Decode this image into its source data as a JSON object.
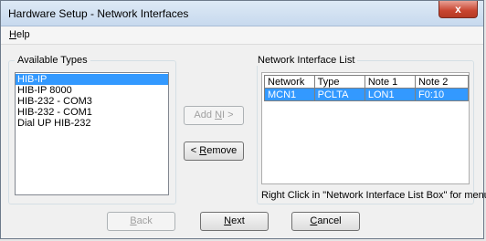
{
  "window": {
    "title": "Hardware Setup - Network Interfaces",
    "close_glyph": "x"
  },
  "menu": {
    "help_mnemonic": "H",
    "help_rest": "elp"
  },
  "available_types": {
    "label": "Available Types",
    "items": [
      "HIB-IP",
      "HIB-IP 8000",
      "HIB-232 - COM3",
      "HIB-232 - COM1",
      "Dial UP HIB-232"
    ],
    "selected_index": 0
  },
  "buttons": {
    "add_ni_prefix": "Add ",
    "add_ni_mnemonic": "N",
    "add_ni_suffix": "I >",
    "remove_prefix": "< ",
    "remove_mnemonic": "R",
    "remove_suffix": "emove",
    "back_mnemonic": "B",
    "back_rest": "ack",
    "next_mnemonic": "N",
    "next_rest": "ext",
    "cancel_mnemonic": "C",
    "cancel_rest": "ancel"
  },
  "network_interface_list": {
    "label": "Network Interface List",
    "columns": [
      "Network",
      "Type",
      "Note 1",
      "Note 2"
    ],
    "rows": [
      {
        "network": "MCN1",
        "type": "PCLTA",
        "note1": "LON1",
        "note2": "F0:10"
      }
    ],
    "hint": "Right Click in \"Network Interface List Box\" for menu."
  }
}
